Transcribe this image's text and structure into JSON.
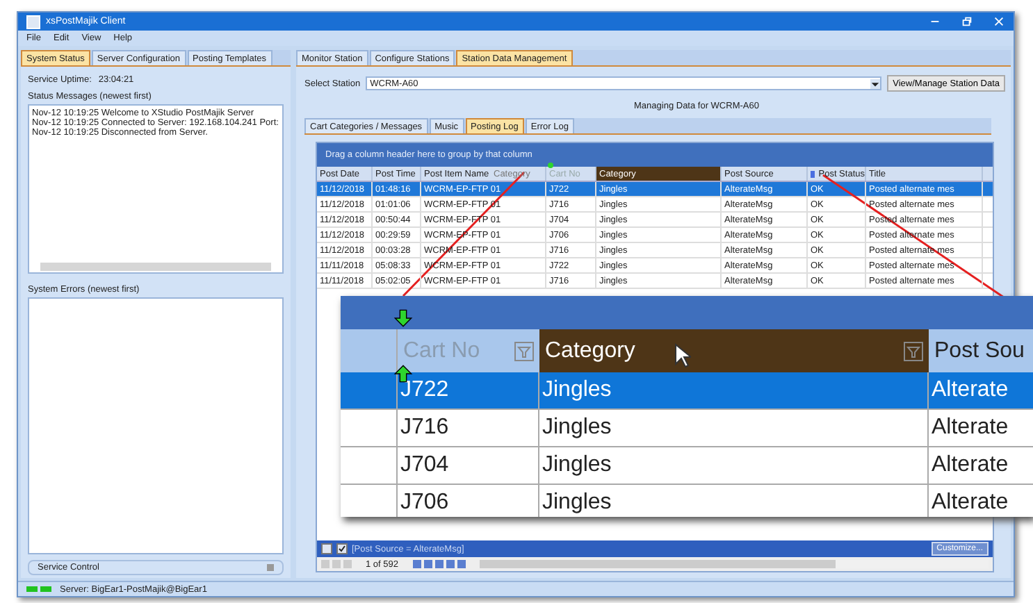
{
  "window": {
    "title": "xsPostMajik Client"
  },
  "menu": [
    "File",
    "Edit",
    "View",
    "Help"
  ],
  "left_tabs": [
    {
      "label": "System Status",
      "selected": true
    },
    {
      "label": "Server Configuration",
      "selected": false
    },
    {
      "label": "Posting Templates",
      "selected": false
    }
  ],
  "uptime": {
    "label": "Service Uptime:",
    "value": "23:04:21"
  },
  "status_messages": {
    "label": "Status Messages (newest first)",
    "lines": [
      "Nov-12 10:19:25  Welcome to XStudio PostMajik Server",
      "Nov-12 10:19:25  Connected to Server: 192.168.104.241 Port:",
      "Nov-12 10:19:25  Disconnected from Server."
    ]
  },
  "system_errors": {
    "label": "System Errors (newest first)"
  },
  "service_control": {
    "label": "Service Control"
  },
  "right_tabs": [
    {
      "label": "Monitor Station",
      "selected": false
    },
    {
      "label": "Configure Stations",
      "selected": false
    },
    {
      "label": "Station Data Management",
      "selected": true
    }
  ],
  "station": {
    "label": "Select Station",
    "value": "WCRM-A60",
    "button": "View/Manage Station Data"
  },
  "managing_label": "Managing Data for WCRM-A60",
  "sub_tabs": [
    {
      "label": "Cart Categories / Messages",
      "selected": false
    },
    {
      "label": "Music",
      "selected": false
    },
    {
      "label": "Posting Log",
      "selected": true
    },
    {
      "label": "Error Log",
      "selected": false
    }
  ],
  "grid": {
    "group_hint": "Drag a column header here to group by that column",
    "drag_ghost": "Category",
    "columns": [
      {
        "label": "Post Date",
        "kind": "normal"
      },
      {
        "label": "Post Time",
        "kind": "normal"
      },
      {
        "label": "Post Item Name",
        "kind": "normal"
      },
      {
        "label": "Cart No",
        "kind": "dragged"
      },
      {
        "label": "Category",
        "kind": "hot"
      },
      {
        "label": "Post Source",
        "kind": "normal"
      },
      {
        "label": "Post Status",
        "kind": "marked"
      },
      {
        "label": "Title",
        "kind": "normal"
      }
    ],
    "rows": [
      {
        "selected": true,
        "cells": [
          "11/12/2018",
          "01:48:16",
          "WCRM-EP-FTP 01",
          "J722",
          "Jingles",
          "AlterateMsg",
          "OK",
          "Posted alternate mes"
        ]
      },
      {
        "selected": false,
        "cells": [
          "11/12/2018",
          "01:01:06",
          "WCRM-EP-FTP 01",
          "J716",
          "Jingles",
          "AlterateMsg",
          "OK",
          "Posted alternate mes"
        ]
      },
      {
        "selected": false,
        "cells": [
          "11/12/2018",
          "00:50:44",
          "WCRM-EP-FTP 01",
          "J704",
          "Jingles",
          "AlterateMsg",
          "OK",
          "Posted alternate mes"
        ]
      },
      {
        "selected": false,
        "cells": [
          "11/12/2018",
          "00:29:59",
          "WCRM-EP-FTP 01",
          "J706",
          "Jingles",
          "AlterateMsg",
          "OK",
          "Posted alternate mes"
        ]
      },
      {
        "selected": false,
        "cells": [
          "11/12/2018",
          "00:03:28",
          "WCRM-EP-FTP 01",
          "J716",
          "Jingles",
          "AlterateMsg",
          "OK",
          "Posted alternate mes"
        ]
      },
      {
        "selected": false,
        "cells": [
          "11/11/2018",
          "05:08:33",
          "WCRM-EP-FTP 01",
          "J722",
          "Jingles",
          "AlterateMsg",
          "OK",
          "Posted alternate mes"
        ]
      },
      {
        "selected": false,
        "cells": [
          "11/11/2018",
          "05:02:05",
          "WCRM-EP-FTP 01",
          "J716",
          "Jingles",
          "AlterateMsg",
          "OK",
          "Posted alternate mes"
        ]
      }
    ],
    "filter_enabled": true,
    "filter": "[Post Source = AlterateMsg]",
    "customize": "Customize...",
    "pager": "1 of 592"
  },
  "magnifier": {
    "columns": [
      {
        "label": "Cart No",
        "kind": "dragged"
      },
      {
        "label": "Category",
        "kind": "hot"
      },
      {
        "label": "Post Sou",
        "kind": "normal"
      }
    ],
    "rows": [
      {
        "selected": true,
        "cells": [
          "J722",
          "Jingles",
          "Alterate"
        ]
      },
      {
        "selected": false,
        "cells": [
          "J716",
          "Jingles",
          "Alterate"
        ]
      },
      {
        "selected": false,
        "cells": [
          "J704",
          "Jingles",
          "Alterate"
        ]
      },
      {
        "selected": false,
        "cells": [
          "J706",
          "Jingles",
          "Alterate"
        ]
      }
    ]
  },
  "status_bar": {
    "text": "Server: BigEar1-PostMajik@BigEar1"
  }
}
